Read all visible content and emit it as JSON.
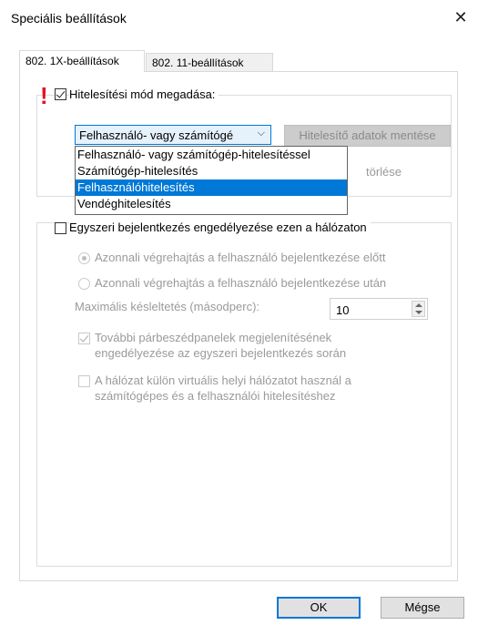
{
  "window": {
    "title": "Speciális beállítások",
    "close_glyph": "✕"
  },
  "tabs": [
    {
      "label": "802. 1X-beállítások",
      "selected": true
    },
    {
      "label": "802. 11-beállítások",
      "selected": false
    }
  ],
  "auth_mode": {
    "warning_glyph": "!",
    "checkbox_label": "Hitelesítési mód megadása:",
    "checked": true,
    "combo_value": "Felhasználó- vagy számítógé",
    "combo_chevron": "⌵",
    "save_button_label": "Hitelesítő adatok mentése",
    "delete_text": "törlése",
    "dropdown_options": [
      "Felhasználó- vagy számítógép-hitelesítéssel",
      "Számítógép-hitelesítés",
      "Felhasználóhitelesítés",
      "Vendéghitelesítés"
    ],
    "selected_option_index": 2
  },
  "sso": {
    "checkbox_label": "Egyszeri bejelentkezés engedélyezése ezen a hálózaton",
    "checked": false,
    "radio_before_label": "Azonnali végrehajtás a felhasználó bejelentkezése előtt",
    "radio_after_label": "Azonnali végrehajtás a felhasználó bejelentkezése után",
    "delay_label": "Maximális késleltetés (másodperc):",
    "delay_value": "10",
    "dialogs_label_line1": "További párbeszédpanelek megjelenítésének",
    "dialogs_label_line2": "engedélyezése az egyszeri bejelentkezés során",
    "vlan_label_line1": "A hálózat külön virtuális helyi hálózatot használ a",
    "vlan_label_line2": "számítógépes és a felhasználói hitelesítéshez"
  },
  "buttons": {
    "ok": "OK",
    "cancel": "Mégse"
  },
  "colors": {
    "accent": "#0078d7",
    "warning": "#e81123"
  }
}
